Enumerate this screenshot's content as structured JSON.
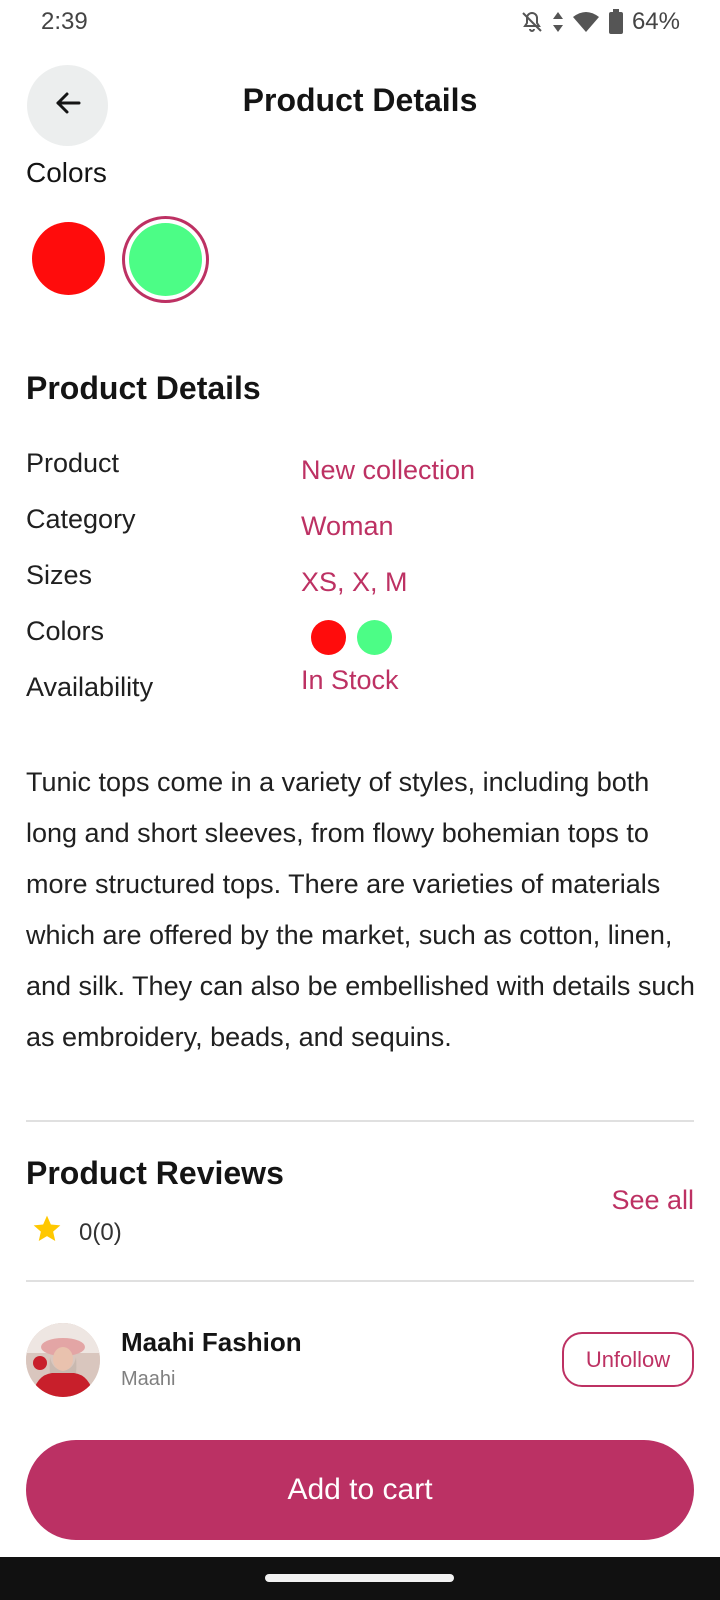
{
  "status_bar": {
    "time": "2:39",
    "battery": "64%",
    "icons": [
      "bell-off-icon",
      "data-arrows-icon",
      "wifi-icon",
      "battery-icon"
    ]
  },
  "header": {
    "title": "Product Details",
    "back_icon": "arrow-left-icon"
  },
  "colors_section": {
    "label": "Colors",
    "swatches": [
      {
        "color": "#ff0c0c",
        "selected": false
      },
      {
        "color": "#4cfd86",
        "selected": true
      }
    ]
  },
  "details_section": {
    "heading": "Product Details",
    "rows": [
      {
        "label": "Product",
        "value": "New collection"
      },
      {
        "label": "Category",
        "value": "Woman"
      },
      {
        "label": "Sizes",
        "value": "XS, X, M"
      },
      {
        "label": "Colors",
        "value_colors": [
          "#ff0c0c",
          "#4cfd86"
        ]
      },
      {
        "label": "Availability",
        "value": "In Stock"
      }
    ],
    "description": "Tunic tops come in a variety of styles, including both long and short sleeves, from flowy bohemian tops to more structured tops. There are varieties of materials which are offered by the market, such as cotton, linen, and silk. They can also be embellished with details such as embroidery, beads, and sequins."
  },
  "reviews": {
    "heading": "Product Reviews",
    "rating": "0(0)",
    "star_icon": "star-icon",
    "see_all": "See all"
  },
  "seller": {
    "name": "Maahi Fashion",
    "handle": "Maahi",
    "follow_button": "Unfollow"
  },
  "cart_button": "Add to cart",
  "theme": {
    "accent": "#bd3163",
    "button": "#bb3164",
    "star": "#ffc800"
  }
}
